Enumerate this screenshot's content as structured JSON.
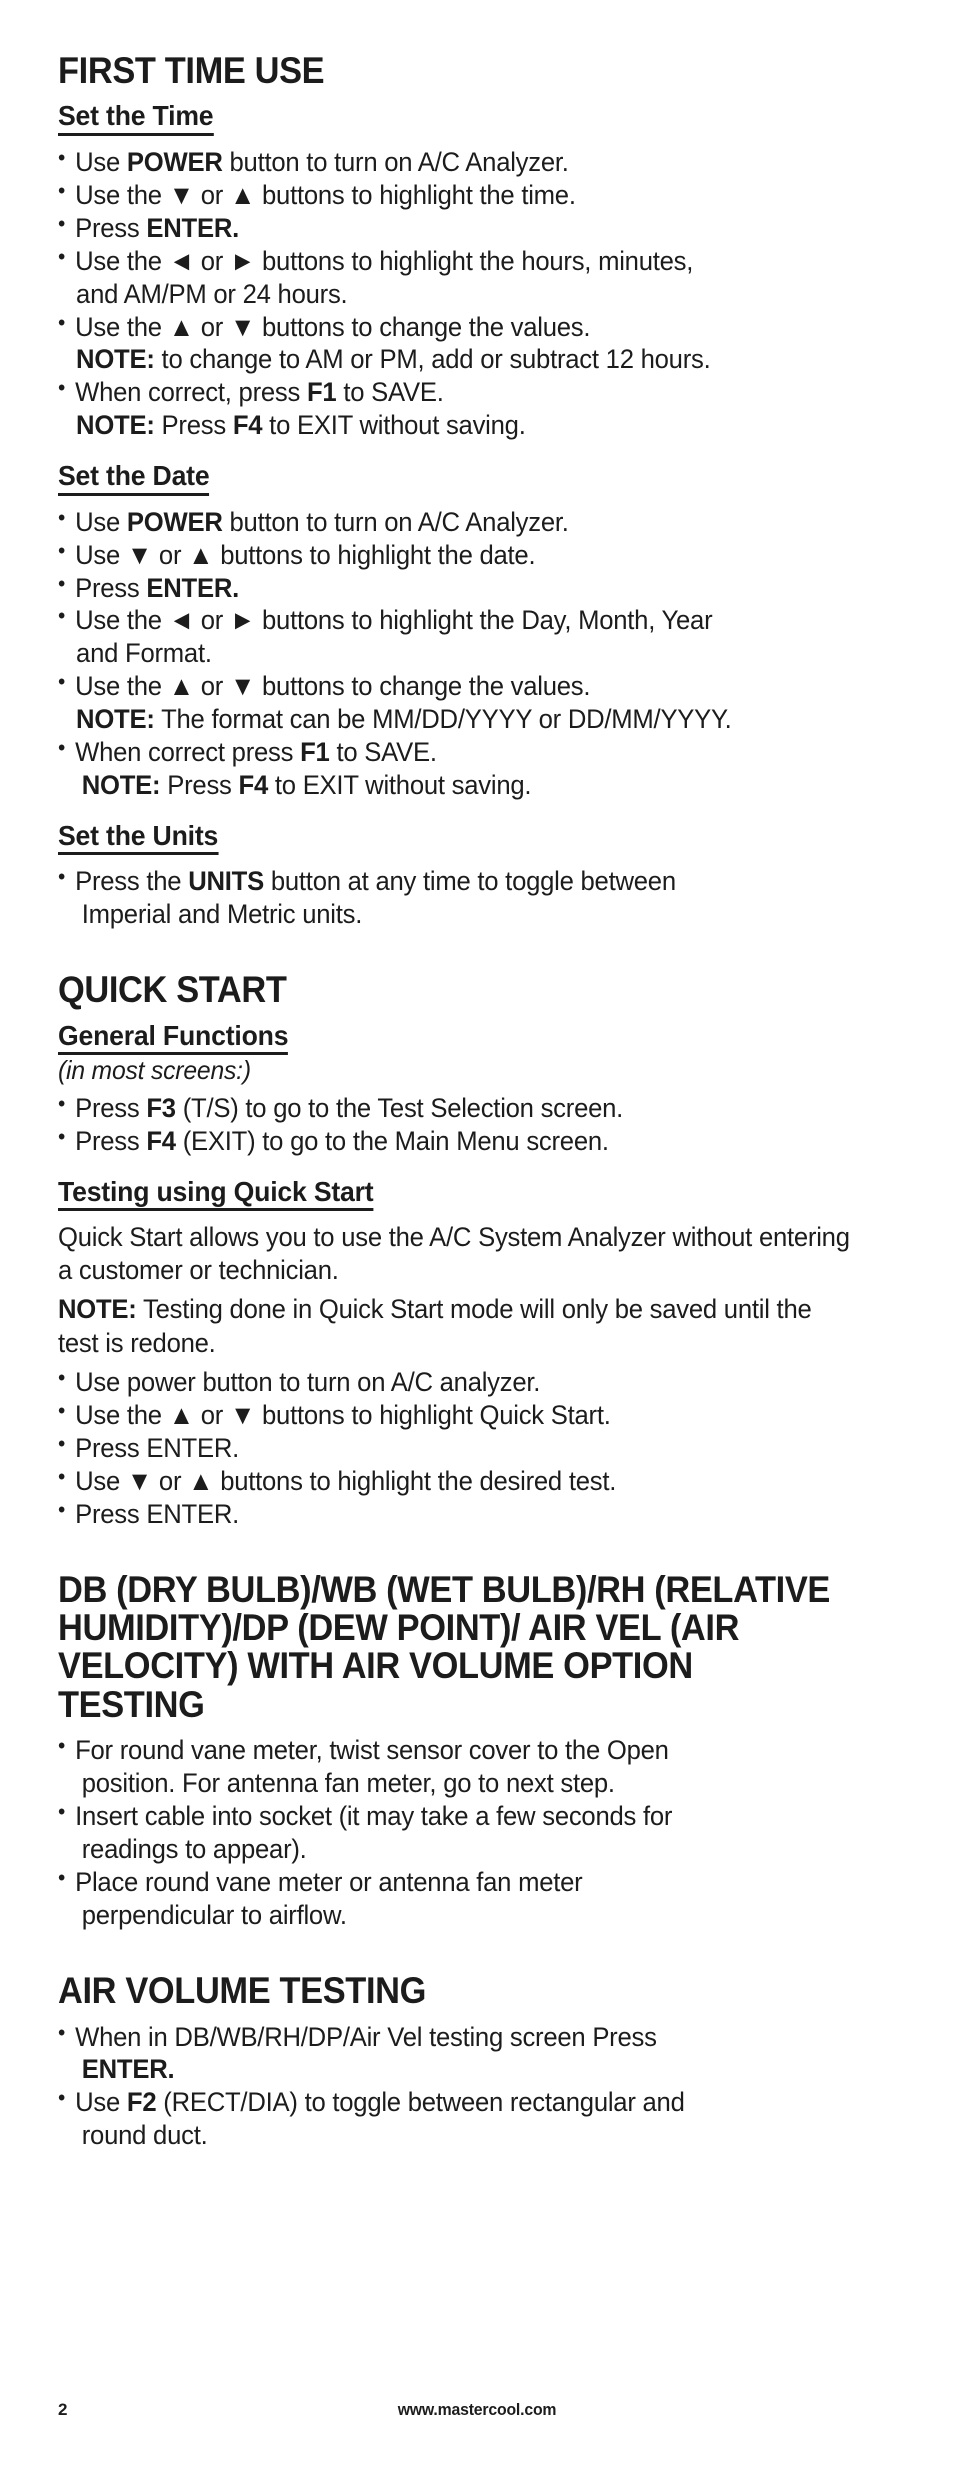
{
  "page": {
    "number": "2",
    "footer_site": "www.mastercool.com"
  },
  "sections": [
    {
      "id": "first-time-use",
      "heading": "FIRST TIME USE",
      "subsections": [
        {
          "id": "set-the-time",
          "subheading": "Set the Time",
          "bullets": [
            {
              "pre": "Use ",
              "bold": "POWER",
              "post": " button to turn on A/C Analyzer."
            },
            {
              "pre": "Use the ▼ or ▲ buttons to highlight the time.",
              "bold": "",
              "post": ""
            },
            {
              "pre": "Press ",
              "bold": "ENTER.",
              "post": ""
            },
            {
              "pre": "Use the ◄ or ► buttons to highlight the hours, minutes,",
              "bold": "",
              "post": "",
              "cont": "and AM/PM or 24 hours."
            },
            {
              "pre": "Use the ▲ or ▼ buttons to change the values.",
              "bold": "",
              "post": "",
              "note_bold": "NOTE:",
              "note": " to change to AM or PM, add or subtract 12 hours."
            },
            {
              "pre": "When correct, press ",
              "bold": "F1",
              "post": " to SAVE.",
              "note_bold": "NOTE:",
              "note": " Press ",
              "note_bold2": "F4",
              "note2": " to EXIT without saving."
            }
          ]
        },
        {
          "id": "set-the-date",
          "subheading": "Set the Date",
          "bullets": [
            {
              "pre": "Use ",
              "bold": "POWER",
              "post": " button to turn on A/C Analyzer."
            },
            {
              "pre": "Use ▼ or ▲ buttons to highlight the date.",
              "bold": "",
              "post": ""
            },
            {
              "pre": "Press ",
              "bold": "ENTER.",
              "post": ""
            },
            {
              "pre": "Use the ◄ or ► buttons to highlight the Day, Month, Year",
              "bold": "",
              "post": "",
              "cont": "and Format."
            },
            {
              "pre": "Use the ▲ or ▼ buttons to change the values.",
              "bold": "",
              "post": "",
              "note_bold": "NOTE:",
              "note": " The format can be MM/DD/YYYY or DD/MM/YYYY."
            },
            {
              "pre": "When correct press ",
              "bold": "F1",
              "post": " to SAVE.",
              "note_bold": "NOTE:",
              "note": " Press ",
              "note_bold2": "F4",
              "note2": " to EXIT without saving."
            }
          ]
        },
        {
          "id": "set-the-units",
          "subheading": "Set the Units",
          "bullets": [
            {
              "pre": "Press the ",
              "bold": "UNITS",
              "post": " button at any time to toggle between",
              "cont": "Imperial and Metric units."
            }
          ]
        }
      ]
    },
    {
      "id": "quick-start",
      "heading": "QUICK START",
      "subsections": [
        {
          "id": "general-functions",
          "subheading": "General Functions",
          "italic_line": "(in most screens:)",
          "bullets": [
            {
              "pre": "Press ",
              "bold": "F3",
              "post": " (T/S) to go to the Test Selection screen."
            },
            {
              "pre": "Press ",
              "bold": "F4",
              "post": " (EXIT) to go to the Main Menu screen."
            }
          ]
        },
        {
          "id": "testing-using-quick-start",
          "subheading": "Testing using Quick Start",
          "paragraphs": [
            {
              "bold": "",
              "text": "Quick Start allows you to use the A/C System Analyzer without entering a customer or technician."
            },
            {
              "bold": "NOTE:",
              "text": " Testing done in Quick Start mode will only be saved until the test is redone."
            }
          ],
          "bullets": [
            {
              "pre": "Use power button to turn on A/C analyzer.",
              "bold": "",
              "post": ""
            },
            {
              "pre": "Use the ▲ or ▼ buttons to highlight Quick Start.",
              "bold": "",
              "post": ""
            },
            {
              "pre": "Press ENTER.",
              "bold": "",
              "post": ""
            },
            {
              "pre": "Use ▼ or ▲ buttons to highlight the desired test.",
              "bold": "",
              "post": ""
            },
            {
              "pre": "Press ENTER.",
              "bold": "",
              "post": ""
            }
          ]
        }
      ]
    },
    {
      "id": "db-wb-rh-dp-airvel",
      "heading": "DB (DRY BULB)/WB (WET BULB)/RH (RELATIVE HUMIDITY)/DP (DEW POINT)/ AIR VEL (AIR VELOCITY) WITH AIR VOLUME OPTION TESTING",
      "subsections": [
        {
          "id": "db-wb-steps",
          "subheading": "",
          "bullets": [
            {
              "pre": "For round vane meter, twist sensor cover to the Open",
              "bold": "",
              "post": "",
              "cont": "position. For antenna fan meter, go to next step."
            },
            {
              "pre": "Insert cable into socket (it may take a few seconds for",
              "bold": "",
              "post": "",
              "cont": "readings to appear)."
            },
            {
              "pre": "Place round vane meter or antenna fan meter",
              "bold": "",
              "post": "",
              "cont": "perpendicular to airflow."
            }
          ]
        }
      ]
    },
    {
      "id": "air-volume-testing",
      "heading": "AIR VOLUME TESTING",
      "subsections": [
        {
          "id": "air-volume-steps",
          "subheading": "",
          "bullets": [
            {
              "pre": "When in DB/WB/RH/DP/Air Vel testing screen Press",
              "bold": "",
              "post": "",
              "cont_bold": "ENTER."
            },
            {
              "pre": "Use ",
              "bold": "F2",
              "post": " (RECT/DIA) to toggle between rectangular and",
              "cont": "round duct."
            }
          ]
        }
      ]
    }
  ]
}
